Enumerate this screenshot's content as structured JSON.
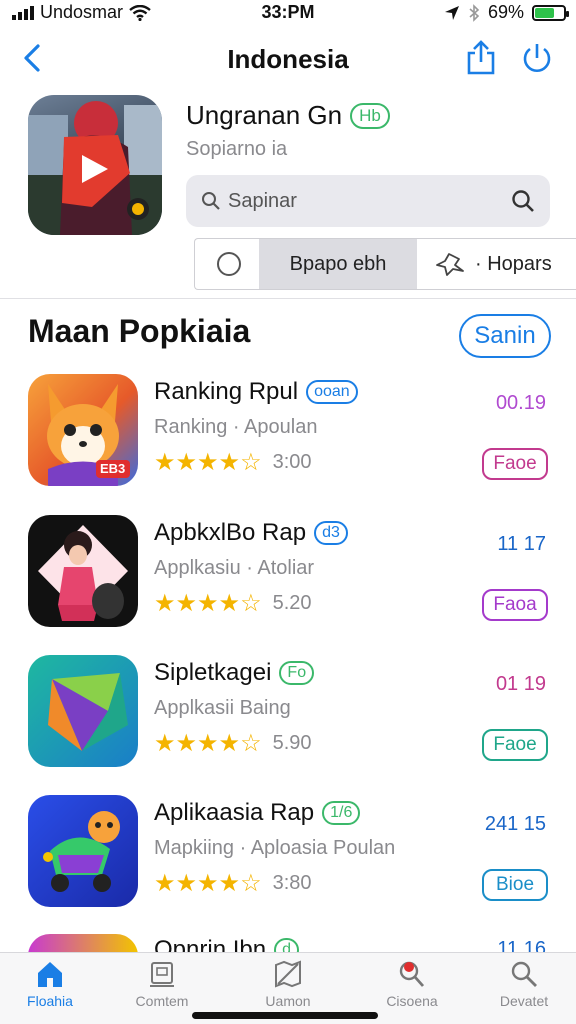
{
  "status_bar": {
    "carrier": "Undosmar",
    "time": "33:PM",
    "battery": "69%",
    "battery_level": 0.69
  },
  "nav": {
    "title": "Indonesia",
    "back_icon": "chevron-left-icon",
    "share_icon": "share-icon",
    "power_icon": "power-icon"
  },
  "hero": {
    "title": "Ungranan Gn",
    "badge": "Hb",
    "subtitle": "Sopiarno ia",
    "search_placeholder": "Sapinar",
    "segment_middle": "Bpapo ebh",
    "segment_right": "Hopars"
  },
  "section": {
    "title": "Maan Popkiaia",
    "button": "Sanin"
  },
  "apps": [
    {
      "name": "Ranking Rpul",
      "tag": "ooan",
      "tag_color": "#1a7ee5",
      "subtitle": "Ranking · Apoulan",
      "rating": "3:00",
      "count": "00.19",
      "count_color": "#b04ad0",
      "button": "Faoe",
      "button_color": "#c23a8e",
      "icon_badge": "EB3"
    },
    {
      "name": "ApbkxlBo Rap",
      "tag": "d3",
      "tag_color": "#1a7ee5",
      "subtitle": "Applkasiu · Atoliar",
      "rating": "5.20",
      "count": "11 17",
      "count_color": "#1a66c8",
      "button": "Faoa",
      "button_color": "#a43acb"
    },
    {
      "name": "Sipletkagei",
      "tag": "Fo",
      "tag_color": "#3bb86a",
      "subtitle": "Applkasii Baing",
      "rating": "5.90",
      "count": "01 19",
      "count_color": "#c23a8e",
      "button": "Faoe",
      "button_color": "#1fa68a"
    },
    {
      "name": "Aplikaasia Rap",
      "tag": "1/6",
      "tag_color": "#3bb86a",
      "subtitle": "Mapkiing · Aploasia Poulan",
      "rating": "3:80",
      "count": "241 15",
      "count_color": "#1a66c8",
      "button": "Bioe",
      "button_color": "#1a8ec8"
    }
  ],
  "partial_app": {
    "name": "Opnrin Ibn",
    "tag": "d",
    "count": "11 16"
  },
  "tabs": [
    {
      "label": "Floahia",
      "icon": "home-icon",
      "active": true
    },
    {
      "label": "Comtem",
      "icon": "store-icon",
      "active": false
    },
    {
      "label": "Uamon",
      "icon": "map-icon",
      "active": false
    },
    {
      "label": "Cisoena",
      "icon": "search-notification-icon",
      "active": false
    },
    {
      "label": "Devatet",
      "icon": "search-icon",
      "active": false
    }
  ]
}
